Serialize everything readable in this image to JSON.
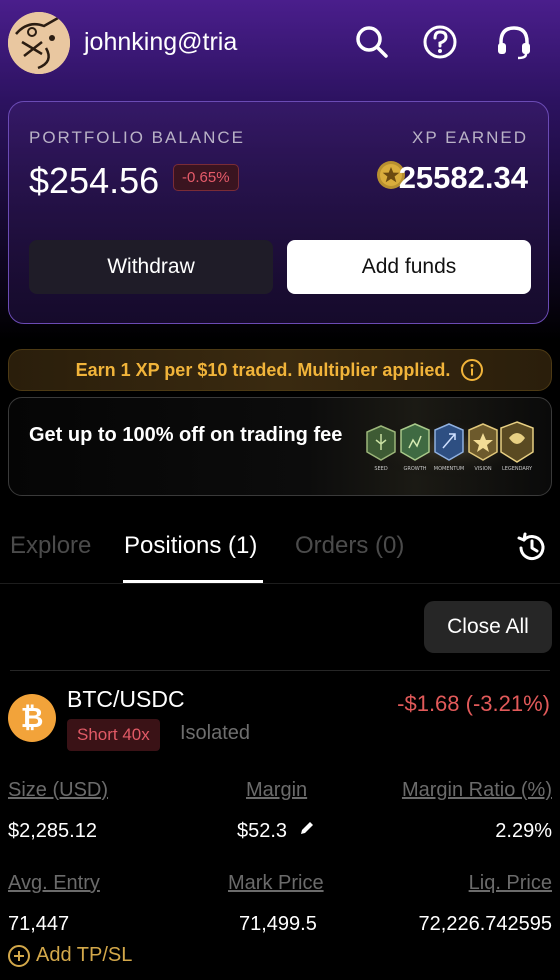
{
  "header": {
    "username": "johnking@tria",
    "icons": [
      "search-icon",
      "help-icon",
      "support-headset-icon"
    ]
  },
  "portfolio": {
    "balance_label": "PORTFOLIO BALANCE",
    "balance": "$254.56",
    "change": "-0.65%",
    "xp_label": "XP EARNED",
    "xp_value": "25582.34",
    "withdraw_label": "Withdraw",
    "add_funds_label": "Add funds"
  },
  "banners": {
    "xp_info": "Earn 1 XP per $10 traded. Multiplier applied.",
    "promo": "Get up to 100% off on trading fee",
    "badge_labels": [
      "SEED",
      "GROWTH",
      "MOMENTUM",
      "VISION",
      "LEGENDARY"
    ]
  },
  "tabs": {
    "explore": "Explore",
    "positions": "Positions (1)",
    "orders": "Orders (0)",
    "active": "positions"
  },
  "actions": {
    "close_all": "Close All"
  },
  "position": {
    "pair": "BTC/USDC",
    "side": "Short 40x",
    "mode": "Isolated",
    "pnl": "-$1.68 (-3.21%)",
    "size_label": "Size (USD)",
    "size": "$2,285.12",
    "margin_label": "Margin",
    "margin": "$52.3",
    "margin_ratio_label": "Margin Ratio (%)",
    "margin_ratio": "2.29%",
    "avg_entry_label": "Avg. Entry",
    "avg_entry": "71,447",
    "mark_price_label": "Mark Price",
    "mark_price": "71,499.5",
    "liq_price_label": "Liq. Price",
    "liq_price": "72,226.742595",
    "add_tpsl": "Add TP/SL"
  },
  "colors": {
    "accent_purple": "#6b4bb5",
    "negative": "#e25a5a",
    "xp_gold": "#f1b43a",
    "tpsl_gold": "#d3a84a",
    "btc_orange": "#f2a33a"
  }
}
